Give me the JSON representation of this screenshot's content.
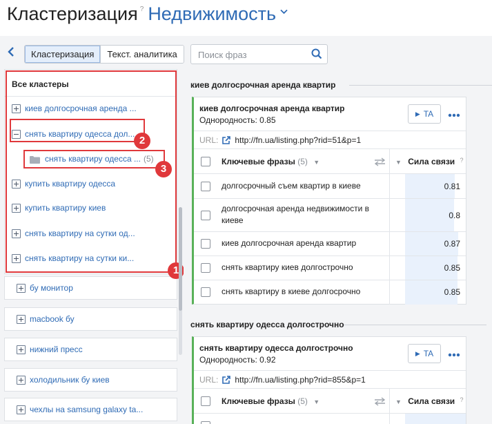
{
  "header": {
    "title": "Кластеризация",
    "help": "?",
    "project": "Недвижимость"
  },
  "toolbar": {
    "tabs": [
      {
        "label": "Кластеризация",
        "active": true
      },
      {
        "label": "Текст. аналитика",
        "active": false
      }
    ],
    "search_placeholder": "Поиск фраз"
  },
  "sidebar": {
    "panel_title": "Все кластеры",
    "items": [
      {
        "label": "киев долгосрочная аренда ...",
        "expanded": false
      },
      {
        "label": "снять квартиру одесса дол...",
        "expanded": true
      },
      {
        "label": "купить квартиру одесса",
        "expanded": false
      },
      {
        "label": "купить квартиру киев",
        "expanded": false
      },
      {
        "label": "снять квартиру на сутки од...",
        "expanded": false
      },
      {
        "label": "снять квартиру на сутки ки...",
        "expanded": false
      }
    ],
    "sub_item": {
      "label": "снять квартиру одесса ...",
      "count": "(5)"
    },
    "cards": [
      {
        "label": "бу монитор"
      },
      {
        "label": "macbook бу"
      },
      {
        "label": "нижний пресс"
      },
      {
        "label": "холодильник бу киев"
      },
      {
        "label": "чехлы на samsung galaxy ta..."
      }
    ],
    "badges": [
      "1",
      "2",
      "3"
    ]
  },
  "main": {
    "groups": [
      {
        "section": "киев долгосрочная аренда квартир",
        "title": "киев долгосрочная аренда квартир",
        "homogeneity": "Однородность: 0.85",
        "ta_label": "TA",
        "url_label": "URL:",
        "url": "http://fn.ua/listing.php?rid=51&p=1",
        "phrases_header": "Ключевые фразы",
        "phrases_count": "(5)",
        "strength_header": "Сила связи",
        "strength_help": "?",
        "rows": [
          {
            "phrase": "долгосрочный съем квартир в киеве",
            "value": "0.81",
            "level": 0.81
          },
          {
            "phrase": "долгосрочная аренда недвижимости в киеве",
            "value": "0.8",
            "level": 0.8
          },
          {
            "phrase": "киев долгосрочная аренда квартир",
            "value": "0.87",
            "level": 0.87
          },
          {
            "phrase": "снять квартиру киев долгострочно",
            "value": "0.85",
            "level": 0.85
          },
          {
            "phrase": "снять квартиру в киеве долгосрочно",
            "value": "0.85",
            "level": 0.85
          }
        ]
      },
      {
        "section": "снять квартиру одесса долгострочно",
        "title": "снять квартиру одесса долгострочно",
        "homogeneity": "Однородность: 0.92",
        "ta_label": "TA",
        "url_label": "URL:",
        "url": "http://fn.ua/listing.php?rid=855&p=1",
        "phrases_header": "Ключевые фразы",
        "phrases_count": "(5)",
        "strength_header": "Сила связи",
        "strength_help": "?"
      }
    ]
  },
  "colors": {
    "accent": "#2f6bb5",
    "annotation_red": "#e0383b",
    "group_bar_green": "#59b159",
    "strength_bar": "#e9f1fc"
  }
}
